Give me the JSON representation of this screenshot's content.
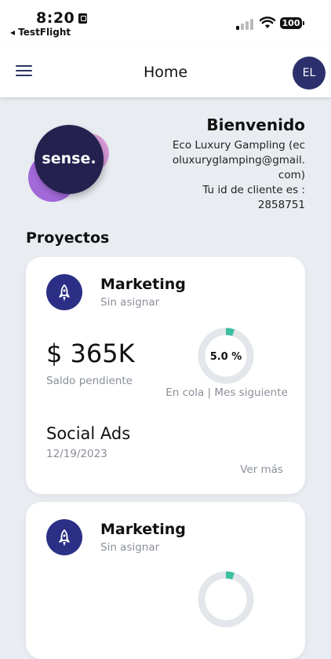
{
  "status_bar": {
    "time": "8:20",
    "back_app": "◂ TestFlight",
    "battery": "100"
  },
  "header": {
    "title": "Home",
    "avatar_initials": "EL"
  },
  "brand": {
    "logo_text": "sense."
  },
  "welcome": {
    "heading": "Bienvenido",
    "line1": "Eco Luxury Gampling (ec",
    "line2": "oluxuryglamping@gmail.",
    "line3": "com)",
    "client_label": "Tu id de cliente es :",
    "client_id": "2858751"
  },
  "projects": {
    "title": "Proyectos",
    "cards": [
      {
        "category": "Marketing",
        "assignee": "Sin asignar",
        "amount": "$ 365K",
        "amount_label": "Saldo pendiente",
        "percent": "5.0 %",
        "percent_value": 0.05,
        "status": "En cola | Mes siguiente",
        "product": "Social Ads",
        "date": "12/19/2023",
        "more": "Ver más"
      },
      {
        "category": "Marketing",
        "assignee": "Sin asignar",
        "percent_value": 0.05
      }
    ]
  },
  "colors": {
    "primary": "#2b2f86",
    "ring_track": "#e3e6ea",
    "ring_fill": "#3ebfa0"
  }
}
